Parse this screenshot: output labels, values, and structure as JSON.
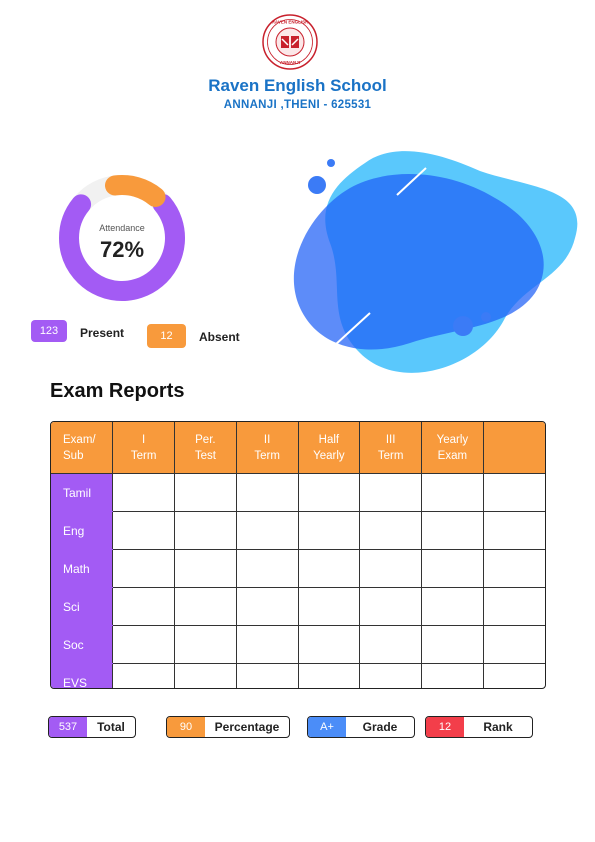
{
  "school": {
    "name": "Raven English School",
    "address": "ANNANJI ,THENI - 625531",
    "logo_icon": "school-crest-icon"
  },
  "attendance": {
    "label": "Attendance",
    "percent_text": "72%",
    "percent": 72,
    "present_count": "123",
    "present_label": "Present",
    "absent_count": "12",
    "absent_label": "Absent"
  },
  "exam_reports": {
    "title": "Exam Reports",
    "columns": [
      "Exam/\nSub",
      "I\nTerm",
      "Per.\nTest",
      "II\nTerm",
      "Half\nYearly",
      "III\nTerm",
      "Yearly\nExam",
      ""
    ],
    "subjects": [
      "Tamil",
      "Eng",
      "Math",
      "Sci",
      "Soc",
      "EVS"
    ]
  },
  "summary": {
    "total_value": "537",
    "total_label": "Total",
    "percentage_value": "90",
    "percentage_label": "Percentage",
    "grade_value": "A+",
    "grade_label": "Grade",
    "rank_value": "12",
    "rank_label": "Rank"
  },
  "colors": {
    "brand_blue": "#1a73c6",
    "purple": "#a35bf4",
    "orange": "#f89a3c",
    "blue": "#4b8df8",
    "red": "#f33e4a"
  }
}
